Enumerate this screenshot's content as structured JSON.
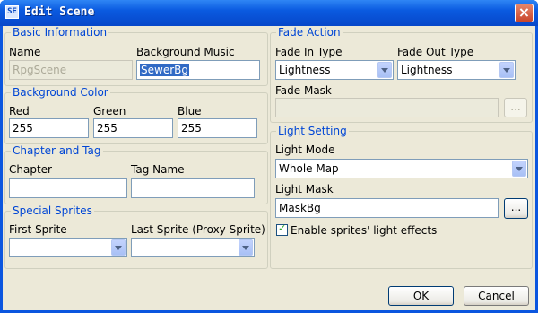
{
  "window": {
    "title": "Edit Scene",
    "icon": "app-icon",
    "close": "×"
  },
  "basic_info": {
    "legend": "Basic Information",
    "name_label": "Name",
    "name_value": "RpgScene",
    "bgm_label": "Background Music",
    "bgm_value": "SewerBg"
  },
  "bg_color": {
    "legend": "Background Color",
    "red_label": "Red",
    "red_value": "255",
    "green_label": "Green",
    "green_value": "255",
    "blue_label": "Blue",
    "blue_value": "255"
  },
  "chapter_tag": {
    "legend": "Chapter and Tag",
    "chapter_label": "Chapter",
    "chapter_value": "",
    "tag_label": "Tag Name",
    "tag_value": ""
  },
  "special_sprites": {
    "legend": "Special Sprites",
    "first_label": "First Sprite",
    "first_value": "",
    "last_label": "Last Sprite (Proxy Sprite)",
    "last_value": ""
  },
  "fade_action": {
    "legend": "Fade Action",
    "fade_in_label": "Fade In Type",
    "fade_in_value": "Lightness",
    "fade_out_label": "Fade Out Type",
    "fade_out_value": "Lightness",
    "mask_label": "Fade Mask",
    "mask_value": "",
    "browse_label": "..."
  },
  "light_setting": {
    "legend": "Light Setting",
    "mode_label": "Light Mode",
    "mode_value": "Whole Map",
    "mask_label": "Light Mask",
    "mask_value": "MaskBg",
    "browse_label": "...",
    "checkbox_label": "Enable sprites' light effects",
    "checkbox_checked": true
  },
  "buttons": {
    "ok": "OK",
    "cancel": "Cancel"
  }
}
